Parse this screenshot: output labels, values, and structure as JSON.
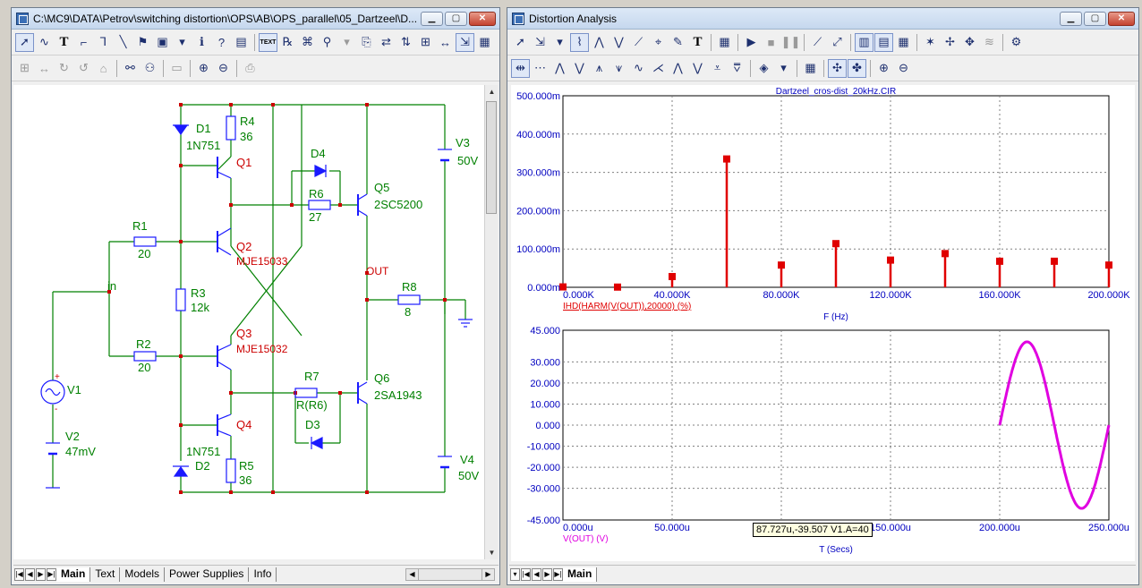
{
  "schematic_window": {
    "title": "C:\\MC9\\DATA\\Petrov\\switching distortion\\OPS\\AB\\OPS_parallel\\05_Dartzeel\\D...",
    "toolbar1_text_btn": "TEXT",
    "tabs": [
      "Main",
      "Text",
      "Models",
      "Power Supplies",
      "Info"
    ],
    "components": {
      "D1": {
        "name": "D1",
        "value": "1N751"
      },
      "R4": {
        "name": "R4",
        "value": "36"
      },
      "Q1": {
        "name": "Q1"
      },
      "D4": {
        "name": "D4"
      },
      "R6": {
        "name": "R6",
        "value": "27"
      },
      "Q5": {
        "name": "Q5",
        "value": "2SC5200"
      },
      "V3": {
        "name": "V3",
        "value": "50V"
      },
      "R1": {
        "name": "R1",
        "value": "20"
      },
      "Q2": {
        "name": "Q2",
        "value": "MJE15033"
      },
      "in": {
        "name": "in"
      },
      "R3": {
        "name": "R3",
        "value": "12k"
      },
      "OUT": {
        "name": "OUT"
      },
      "R8": {
        "name": "R8",
        "value": "8"
      },
      "V1": {
        "name": "V1"
      },
      "R2": {
        "name": "R2",
        "value": "20"
      },
      "Q3": {
        "name": "Q3",
        "value": "MJE15032"
      },
      "R7": {
        "name": "R7",
        "value": "R(R6)"
      },
      "Q6": {
        "name": "Q6",
        "value": "2SA1943"
      },
      "D3": {
        "name": "D3"
      },
      "V2": {
        "name": "V2",
        "value": "47mV"
      },
      "Q4": {
        "name": "Q4"
      },
      "D2": {
        "name": "D2",
        "value": "1N751"
      },
      "R5": {
        "name": "R5",
        "value": "36"
      },
      "V4": {
        "name": "V4",
        "value": "50V"
      },
      "plus": "+",
      "minus": "-"
    }
  },
  "analysis_window": {
    "title": "Distortion Analysis",
    "tabs": [
      "Main"
    ],
    "tooltip": "87.727u,-39.507 V1.A=40"
  },
  "colors": {
    "wire": "#008000",
    "symbol": "#1a1aff",
    "label_green": "#008000",
    "label_red": "#cc0000",
    "grid": "#808080",
    "axis_text": "#0000c0",
    "harmonic": "#e00000",
    "waveform": "#e000e0"
  },
  "chart_data": [
    {
      "type": "bar",
      "title": "Dartzeel_cros-dist_20kHz.CIR",
      "xlabel": "F (Hz)",
      "series_label": "IHD(HARM(V(OUT)),20000) (%)",
      "xlim": [
        0,
        200000
      ],
      "ylim": [
        0,
        0.5
      ],
      "x_tick_labels": [
        "0.000K",
        "40.000K",
        "80.000K",
        "120.000K",
        "160.000K",
        "200.000K"
      ],
      "y_tick_labels": [
        "0.000m",
        "100.000m",
        "200.000m",
        "300.000m",
        "400.000m",
        "500.000m"
      ],
      "x": [
        0,
        20000,
        40000,
        60000,
        80000,
        100000,
        120000,
        140000,
        160000,
        180000,
        200000
      ],
      "values": [
        0.001,
        0.0005,
        0.028,
        0.335,
        0.058,
        0.114,
        0.071,
        0.088,
        0.068,
        0.068,
        0.058
      ]
    },
    {
      "type": "line",
      "xlabel": "T (Secs)",
      "series_label": "V(OUT) (V)",
      "xlim": [
        0,
        0.00025
      ],
      "ylim": [
        -45,
        45
      ],
      "x_tick_labels": [
        "0.000u",
        "50.000u",
        "100.000u",
        "150.000u",
        "200.000u",
        "250.000u"
      ],
      "y_tick_labels": [
        "-45.000",
        "-30.000",
        "-20.000",
        "-10.000",
        "0.000",
        "10.000",
        "20.000",
        "30.000",
        "45.000"
      ],
      "amplitude": 39.5,
      "frequency_hz": 20000,
      "t_start": 0.0002,
      "t_end": 0.00025
    }
  ]
}
